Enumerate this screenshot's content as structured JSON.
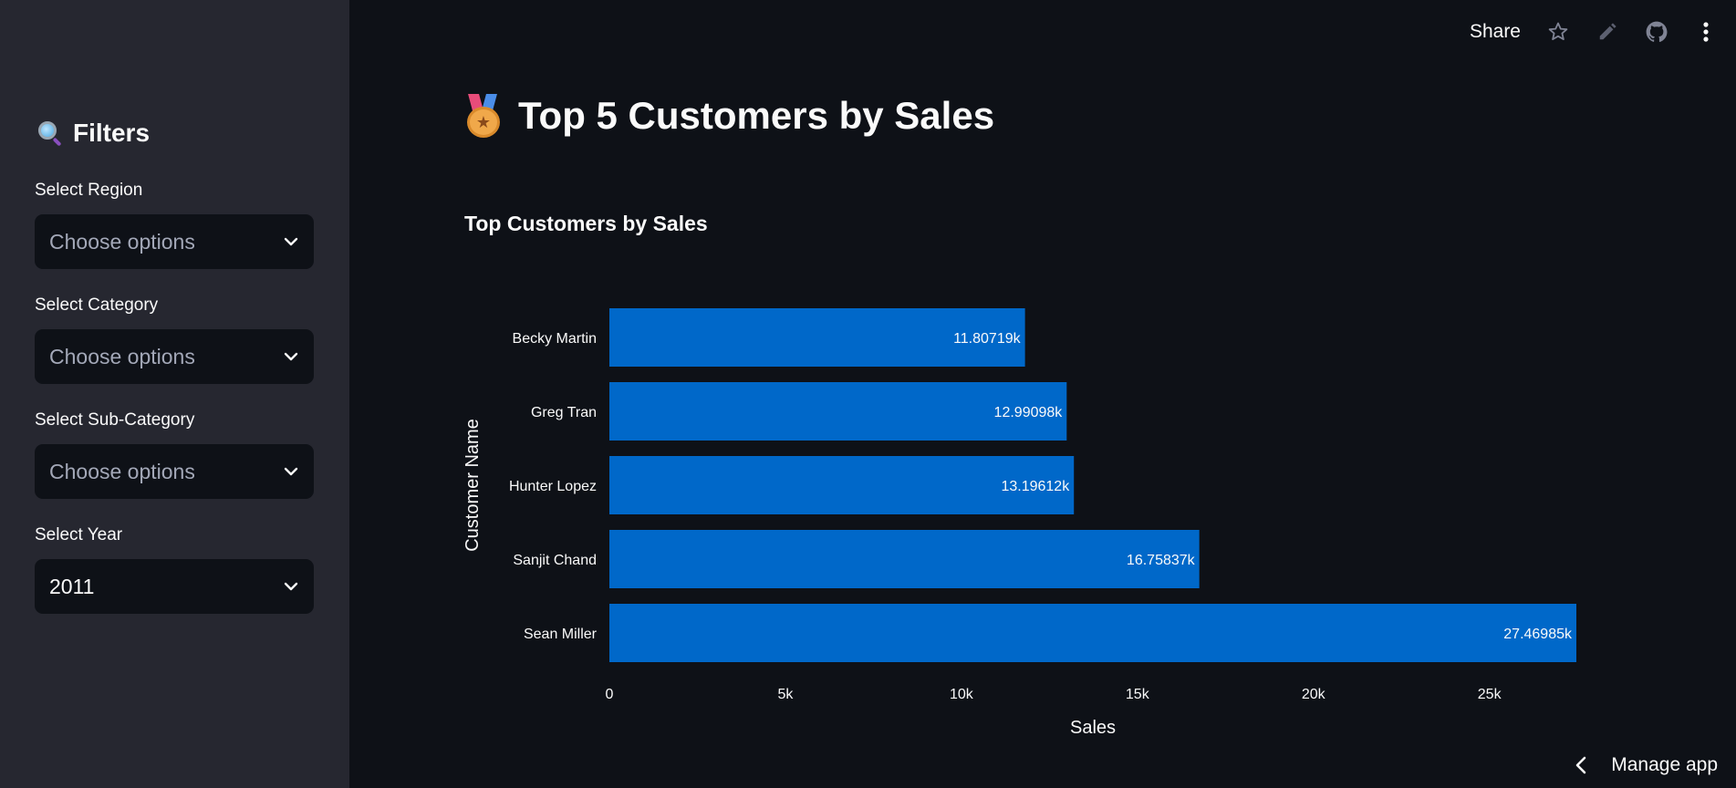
{
  "sidebar": {
    "title": "Filters",
    "title_icon": "magnifying-glass-icon",
    "filters": [
      {
        "label": "Select Region",
        "placeholder": "Choose options",
        "value": ""
      },
      {
        "label": "Select Category",
        "placeholder": "Choose options",
        "value": ""
      },
      {
        "label": "Select Sub-Category",
        "placeholder": "Choose options",
        "value": ""
      },
      {
        "label": "Select Year",
        "placeholder": "",
        "value": "2011"
      }
    ]
  },
  "header": {
    "share_label": "Share",
    "icons": [
      "star-icon",
      "edit-icon",
      "github-icon",
      "more-menu-icon"
    ]
  },
  "main": {
    "title": "Top 5 Customers by Sales",
    "title_icon": "medal-icon",
    "chart_title": "Top Customers by Sales"
  },
  "chart_data": {
    "type": "bar",
    "orientation": "horizontal",
    "categories": [
      "Becky Martin",
      "Greg Tran",
      "Hunter Lopez",
      "Sanjit Chand",
      "Sean Miller"
    ],
    "values": [
      11807.19,
      12990.98,
      13196.12,
      16758.37,
      27469.85
    ],
    "data_labels": [
      "11.80719k",
      "12.99098k",
      "13.19612k",
      "16.75837k",
      "27.46985k"
    ],
    "xticks": [
      "0",
      "5k",
      "10k",
      "15k",
      "20k",
      "25k"
    ],
    "xtick_values": [
      0,
      5000,
      10000,
      15000,
      20000,
      25000
    ],
    "xlim": [
      0,
      27469.85
    ],
    "xlabel": "Sales",
    "ylabel": "Customer Name",
    "bar_color": "#0068c9",
    "grid": false
  },
  "footer": {
    "manage_label": "Manage app"
  },
  "colors": {
    "background": "#0e1117",
    "sidebar": "#262730",
    "text": "#fafafa",
    "placeholder": "#a3a8b8",
    "bar": "#0068c9"
  }
}
